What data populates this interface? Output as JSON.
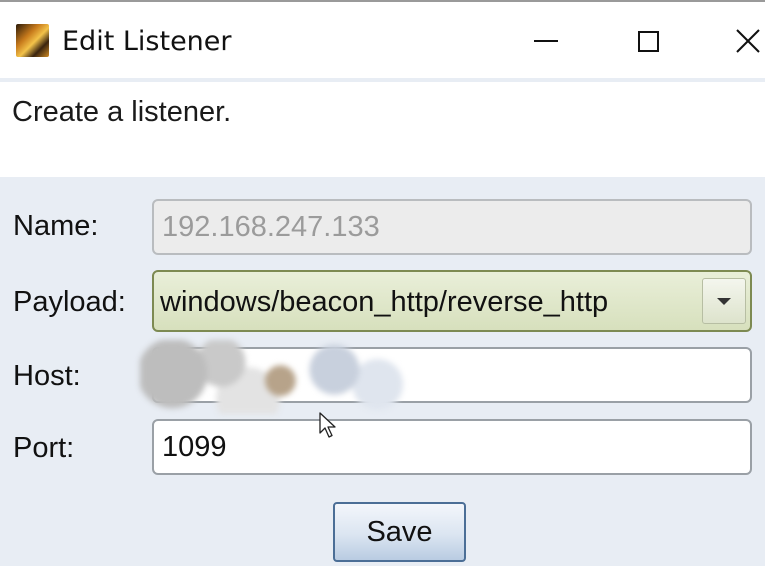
{
  "window": {
    "title": "Edit Listener",
    "icon": "app-icon"
  },
  "description": "Create a listener.",
  "form": {
    "name": {
      "label": "Name:",
      "value": "192.168.247.133",
      "disabled": true
    },
    "payload": {
      "label": "Payload:",
      "selected": "windows/beacon_http/reverse_http"
    },
    "host": {
      "label": "Host:",
      "value": ""
    },
    "port": {
      "label": "Port:",
      "value": "1099"
    }
  },
  "save_label": "Save"
}
